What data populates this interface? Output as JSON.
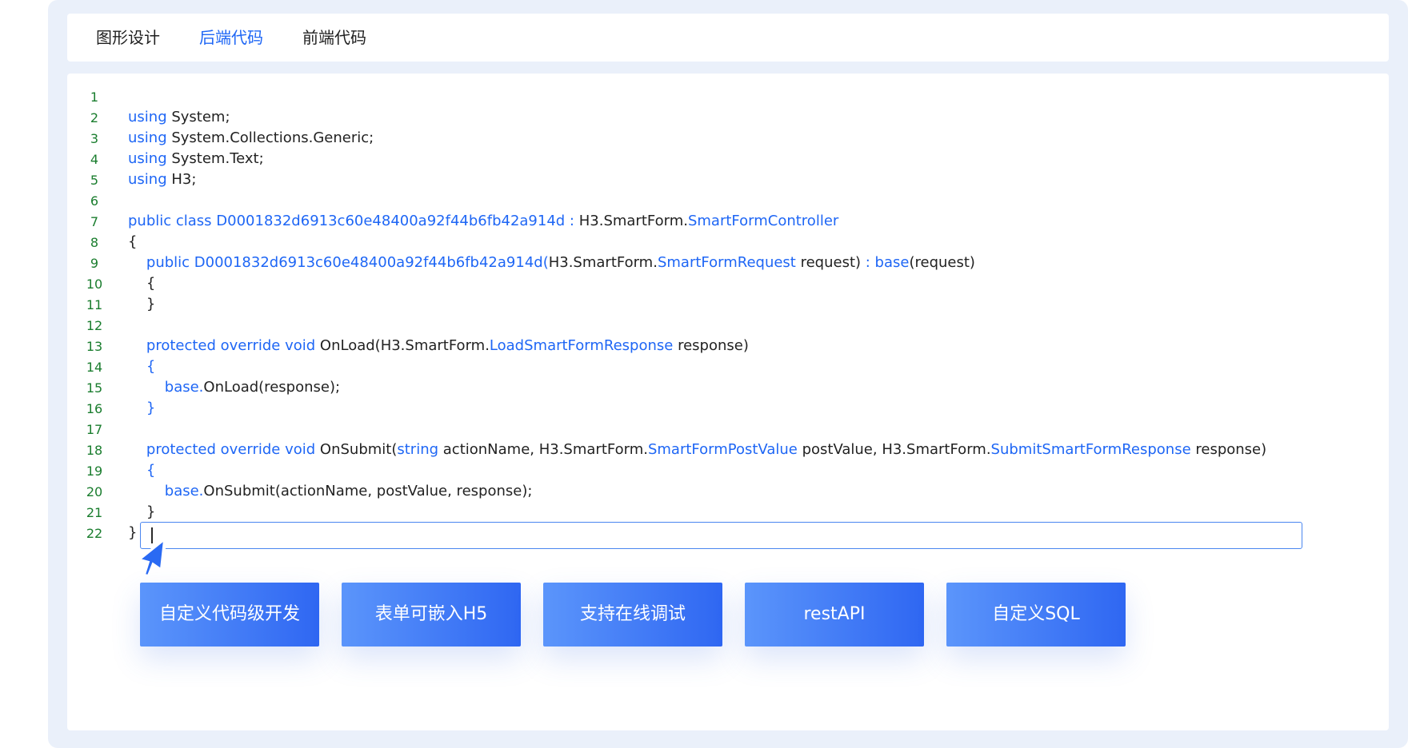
{
  "tabs": [
    {
      "label": "图形设计",
      "active": false
    },
    {
      "label": "后端代码",
      "active": true
    },
    {
      "label": "前端代码",
      "active": false
    }
  ],
  "code_lines": [
    [],
    [
      {
        "t": "using",
        "c": "kw"
      },
      {
        "t": " System;"
      }
    ],
    [
      {
        "t": "using",
        "c": "kw"
      },
      {
        "t": " System.Collections.Generic;"
      }
    ],
    [
      {
        "t": "using",
        "c": "kw"
      },
      {
        "t": " System.Text;"
      }
    ],
    [
      {
        "t": "using",
        "c": "kw"
      },
      {
        "t": " H3;"
      }
    ],
    [],
    [
      {
        "t": "public class D0001832d6913c60e48400a92f44b6fb42a914d : ",
        "c": "kw"
      },
      {
        "t": "H3.SmartForm."
      },
      {
        "t": "SmartFormController",
        "c": "typ"
      }
    ],
    [
      {
        "t": "{"
      }
    ],
    [
      {
        "t": "    public D0001832d6913c60e48400a92f44b6fb42a914d(",
        "c": "kw"
      },
      {
        "t": "H3.SmartForm."
      },
      {
        "t": "SmartFormRequest",
        "c": "typ"
      },
      {
        "t": " request) "
      },
      {
        "t": ": base",
        "c": "kw"
      },
      {
        "t": "(request)"
      }
    ],
    [
      {
        "t": "    {"
      }
    ],
    [
      {
        "t": "    }"
      }
    ],
    [],
    [
      {
        "t": "    protected override void",
        "c": "kw"
      },
      {
        "t": " OnLoad(H3.SmartForm."
      },
      {
        "t": "LoadSmartFormResponse",
        "c": "typ"
      },
      {
        "t": " response)"
      }
    ],
    [
      {
        "t": "    {",
        "c": "kw"
      }
    ],
    [
      {
        "t": "        base.",
        "c": "kw"
      },
      {
        "t": "OnLoad(response);"
      }
    ],
    [
      {
        "t": "    }",
        "c": "kw"
      }
    ],
    [],
    [
      {
        "t": "    protected override void",
        "c": "kw"
      },
      {
        "t": " OnSubmit("
      },
      {
        "t": "string",
        "c": "kw"
      },
      {
        "t": " actionName, H3.SmartForm."
      },
      {
        "t": "SmartFormPostValue",
        "c": "typ"
      },
      {
        "t": " postValue, H3.SmartForm."
      },
      {
        "t": "SubmitSmartFormResponse",
        "c": "typ"
      },
      {
        "t": " response)"
      }
    ],
    [
      {
        "t": "    {",
        "c": "kw"
      }
    ],
    [
      {
        "t": "        base.",
        "c": "kw"
      },
      {
        "t": "OnSubmit(actionName, postValue, response);"
      }
    ],
    [
      {
        "t": "    }"
      }
    ],
    [
      {
        "t": "}"
      }
    ]
  ],
  "input": {
    "value": ""
  },
  "feature_buttons": [
    "自定义代码级开发",
    "表单可嵌入H5",
    "支持在线调试",
    "restAPI",
    "自定义SQL"
  ],
  "colors": {
    "keyword": "#1e66f5",
    "line_number": "#1a7d2e",
    "button_start": "#5b95fb",
    "button_end": "#2f67f2"
  }
}
